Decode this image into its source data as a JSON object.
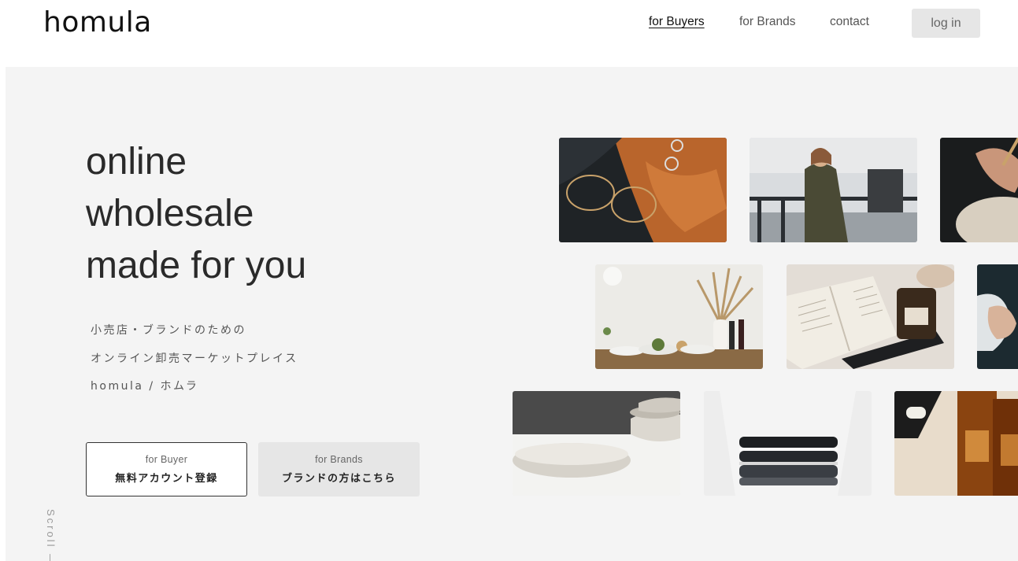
{
  "header": {
    "logo": "homula",
    "nav": {
      "buyers": "for Buyers",
      "brands": "for Brands",
      "contact": "contact"
    },
    "login": "log in"
  },
  "hero": {
    "headline": [
      "online",
      "wholesale",
      "made for you"
    ],
    "sub": [
      "小売店・ブランドのための",
      "オンライン卸売マーケットプレイス",
      "homula / ホムラ"
    ],
    "cta_buyer": {
      "small": "for Buyer",
      "big": "無料アカウント登録"
    },
    "cta_brand": {
      "small": "for Brands",
      "big": "ブランドの方はこちら"
    },
    "scroll": "Scroll —"
  },
  "photos": [
    "glasses-and-rings-photo",
    "woman-with-backpack-photo",
    "pottery-hands-photo",
    "dining-table-photo",
    "book-and-candle-photo",
    "hand-photo",
    "ceramic-bowls-photo",
    "folded-clothes-photo",
    "amber-bottles-photo"
  ]
}
